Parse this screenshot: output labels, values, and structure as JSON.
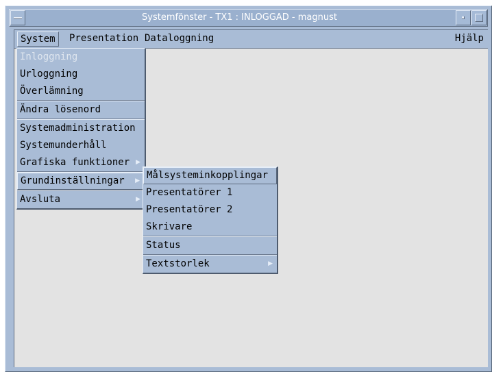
{
  "window": {
    "title": "Systemfönster - TX1 : INLOGGAD - magnust"
  },
  "menubar": {
    "items": [
      "System",
      "Presentation",
      "Dataloggning"
    ],
    "help": "Hjälp"
  },
  "system_menu": {
    "items": [
      "Inloggning",
      "Urloggning",
      "Överlämning",
      "Ändra lösenord",
      "Systemadministration",
      "Systemunderhåll",
      "Grafiska funktioner",
      "Grundinställningar",
      "Avsluta"
    ]
  },
  "submenu": {
    "items": [
      "Målsysteminkopplingar",
      "Presentatörer 1",
      "Presentatörer 2",
      "Skrivare",
      "Status",
      "Textstorlek"
    ]
  },
  "icons": {
    "submenu_arrow": "▶"
  },
  "colors": {
    "frame": "#a9bcd6",
    "client_bg": "#e3e3e3",
    "title_text": "#ffffff"
  }
}
